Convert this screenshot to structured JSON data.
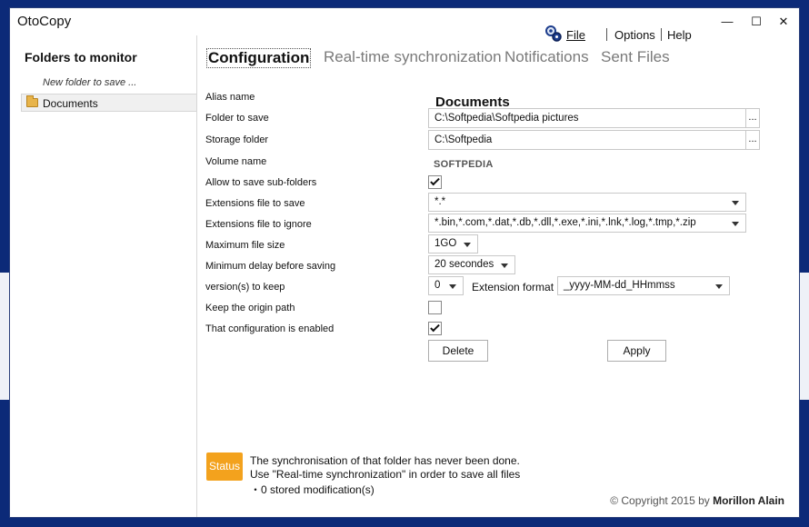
{
  "window": {
    "title": "OtoCopy"
  },
  "menu": {
    "file": "File",
    "options": "Options",
    "help": "Help"
  },
  "sidebar": {
    "title": "Folders to monitor",
    "new_folder": "New folder to save ...",
    "items": [
      {
        "label": "Documents"
      }
    ]
  },
  "tabs": [
    {
      "label": "Configuration",
      "active": true
    },
    {
      "label": "Real-time synchronization",
      "active": false
    },
    {
      "label": "Notifications",
      "active": false
    },
    {
      "label": "Sent Files",
      "active": false
    }
  ],
  "form": {
    "alias_label": "Alias name",
    "alias_value": "Documents",
    "folder_label": "Folder to save",
    "folder_value": "C:\\Softpedia\\Softpedia pictures",
    "storage_label": "Storage folder",
    "storage_value": "C:\\Softpedia",
    "volume_label": "Volume name",
    "volume_value": "SOFTPEDIA",
    "subfolders_label": "Allow to save sub-folders",
    "subfolders_checked": true,
    "ext_save_label": "Extensions file to save",
    "ext_save_value": "*.*",
    "ext_ignore_label": "Extensions file to ignore",
    "ext_ignore_value": "*.bin,*.com,*.dat,*.db,*.dll,*.exe,*.ini,*.lnk,*.log,*.tmp,*.zip",
    "max_size_label": "Maximum file size",
    "max_size_value": "1GO",
    "min_delay_label": " Minimum delay before saving",
    "min_delay_value": "20 secondes",
    "versions_label": "version(s) to keep",
    "versions_value": "0",
    "ext_format_label": "Extension format",
    "ext_format_value": "_yyyy-MM-dd_HHmmss",
    "origin_label": "Keep the origin path",
    "origin_checked": false,
    "enabled_label": "That configuration is enabled",
    "enabled_checked": true,
    "browse_label": "...",
    "delete_label": "Delete",
    "apply_label": "Apply"
  },
  "status": {
    "badge": "Status",
    "line1": "The synchronisation of that folder has never been done.",
    "line2": "Use \"Real-time synchronization\" in order to save all files",
    "line3": "・0 stored modification(s)"
  },
  "footer": {
    "copyright_prefix": "© Copyright 2015 by ",
    "author": "Morillon Alain"
  },
  "colors": {
    "status_badge": "#f3a21d",
    "desktop": "#0c2a78"
  },
  "icons": {
    "file_menu": "gears-icon",
    "folder": "folder-icon"
  }
}
